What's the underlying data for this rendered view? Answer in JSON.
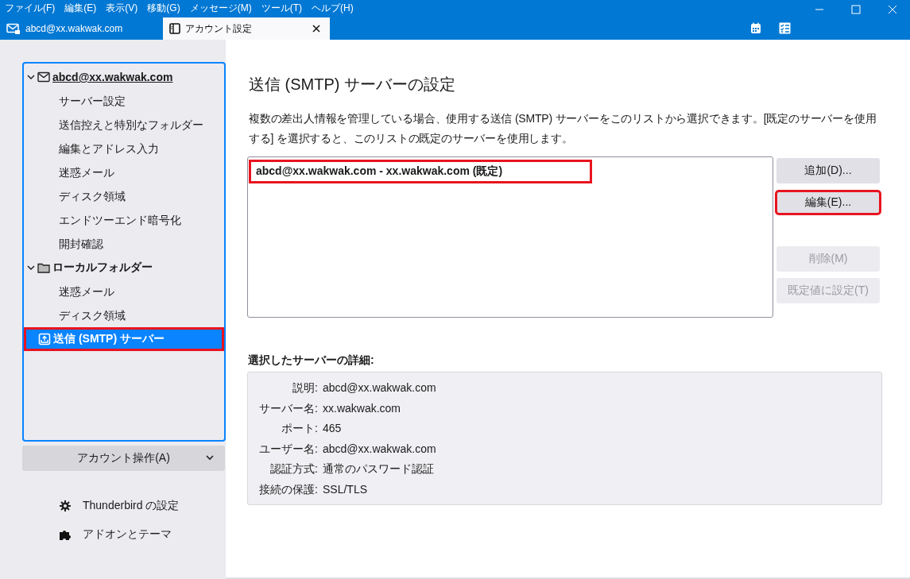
{
  "menu": [
    "ファイル(F)",
    "編集(E)",
    "表示(V)",
    "移動(G)",
    "メッセージ(M)",
    "ツール(T)",
    "ヘルプ(H)"
  ],
  "tabs": [
    {
      "kind": "mail",
      "label": "abcd@xx.wakwak.com",
      "selected": false
    },
    {
      "kind": "settings",
      "label": "アカウント設定",
      "selected": true
    }
  ],
  "sidebar": {
    "accounts": [
      {
        "kind": "mail",
        "name": "abcd@xx.wakwak.com",
        "expanded": true,
        "selected": false,
        "highlighted": false,
        "children": [
          {
            "label": "サーバー設定"
          },
          {
            "label": "送信控えと特別なフォルダー"
          },
          {
            "label": "編集とアドレス入力"
          },
          {
            "label": "迷惑メール"
          },
          {
            "label": "ディスク領域"
          },
          {
            "label": "エンドツーエンド暗号化"
          },
          {
            "label": "開封確認"
          }
        ]
      },
      {
        "kind": "folder",
        "name": "ローカルフォルダー",
        "expanded": true,
        "selected": false,
        "highlighted": false,
        "children": [
          {
            "label": "迷惑メール"
          },
          {
            "label": "ディスク領域"
          }
        ]
      },
      {
        "kind": "outgoing",
        "name": "送信 (SMTP) サーバー",
        "selected": true,
        "highlighted": true
      }
    ],
    "account_actions": "アカウント操作(A)",
    "links": [
      {
        "kind": "gear",
        "label": "Thunderbird の設定"
      },
      {
        "kind": "puzzle",
        "label": "アドオンとテーマ"
      }
    ]
  },
  "main": {
    "title": "送信 (SMTP) サーバーの設定",
    "description": "複数の差出人情報を管理している場合、使用する送信 (SMTP) サーバーをこのリストから選択できます。[既定のサーバーを使用する] を選択すると、このリストの既定のサーバーを使用します。",
    "servers": [
      {
        "label": "abcd@xx.wakwak.com - xx.wakwak.com (既定)",
        "highlighted": true
      }
    ],
    "buttons": [
      {
        "label": "追加(D)...",
        "disabled": false,
        "highlighted": false
      },
      {
        "label": "編集(E)...",
        "disabled": false,
        "highlighted": true
      },
      {
        "label": "削除(M)",
        "disabled": true,
        "highlighted": false
      },
      {
        "label": "既定値に設定(T)",
        "disabled": true,
        "highlighted": false
      }
    ],
    "details_title": "選択したサーバーの詳細:",
    "details": [
      {
        "label": "説明:",
        "value": "abcd@xx.wakwak.com"
      },
      {
        "label": "サーバー名:",
        "value": "xx.wakwak.com"
      },
      {
        "label": "ポート:",
        "value": "465"
      },
      {
        "label": "ユーザー名:",
        "value": "abcd@xx.wakwak.com"
      },
      {
        "label": "認証方式:",
        "value": "通常のパスワード認証"
      },
      {
        "label": "接続の保護:",
        "value": "SSL/TLS"
      }
    ]
  }
}
